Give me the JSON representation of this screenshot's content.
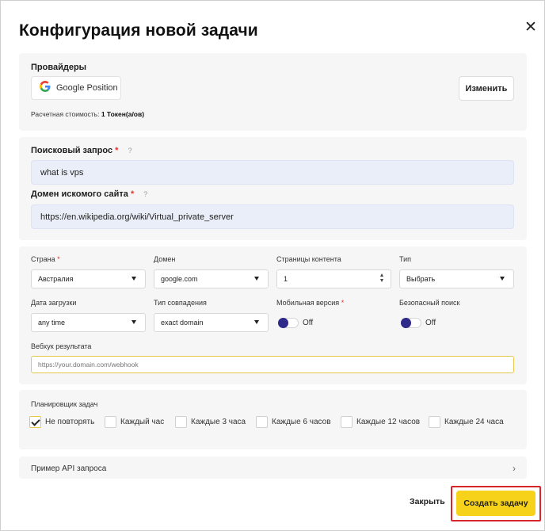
{
  "dialog": {
    "title": "Конфигурация новой задачи",
    "close_icon": "close-icon"
  },
  "providers": {
    "heading": "Провайдеры",
    "provider_name": "Google Position",
    "provider_icon": "google-g-icon",
    "change_label": "Изменить",
    "cost_prefix": "Расчетная стоимость:",
    "cost_value": "1 Токен(а/ов)"
  },
  "search": {
    "query_label": "Поисковый запрос",
    "query_required": "*",
    "query_help": "?",
    "query_value": "what is vps",
    "domain_label": "Домен искомого сайта",
    "domain_required": "*",
    "domain_help": "?",
    "domain_value": "https://en.wikipedia.org/wiki/Virtual_private_server"
  },
  "params": {
    "country_label": "Страна",
    "country_required": "*",
    "country_value": "Австралия",
    "domain_label": "Домен",
    "domain_value": "google.com",
    "pages_label": "Страницы контента",
    "pages_value": "1",
    "type_label": "Тип",
    "type_value": "Выбрать",
    "date_label": "Дата загрузки",
    "date_value": "any time",
    "match_label": "Тип совпадения",
    "match_value": "exact domain",
    "mobile_label": "Мобильная версия",
    "mobile_required": "*",
    "mobile_state": "Off",
    "safe_label": "Безопасный поиск",
    "safe_state": "Off",
    "webhook_label": "Вебхук результата",
    "webhook_placeholder": "https://your.domain.com/webhook",
    "webhook_value": ""
  },
  "scheduler": {
    "heading": "Планировщик задач",
    "options": [
      {
        "label": "Не повторять",
        "checked": true
      },
      {
        "label": "Каждый час",
        "checked": false
      },
      {
        "label": "Каждые 3 часа",
        "checked": false
      },
      {
        "label": "Каждые 6 часов",
        "checked": false
      },
      {
        "label": "Каждые 12 часов",
        "checked": false
      },
      {
        "label": "Каждые 24 часа",
        "checked": false
      }
    ]
  },
  "api": {
    "label": "Пример API запроса",
    "chevron_icon": "chevron-right-icon"
  },
  "footer": {
    "close_label": "Закрыть",
    "create_label": "Создать задачу",
    "highlight_color": "#d6262b",
    "accent_color": "#f6d21a"
  }
}
